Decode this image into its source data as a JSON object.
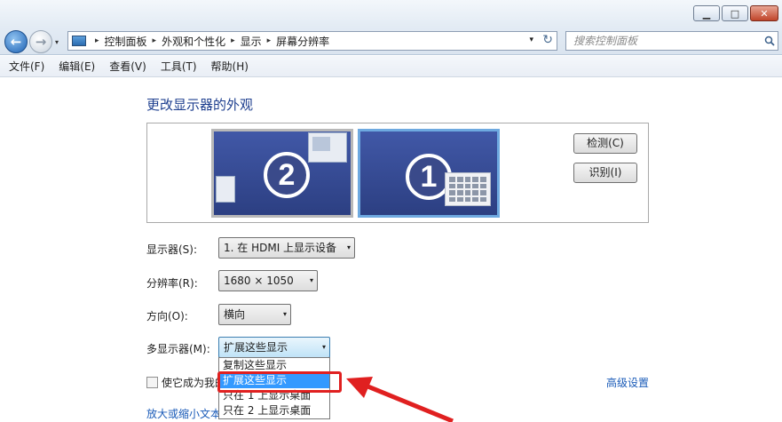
{
  "window": {
    "minimize_glyph": "▁",
    "maximize_glyph": "□",
    "close_glyph": "✕"
  },
  "nav": {
    "back_glyph": "←",
    "forward_glyph": "→",
    "dropdown_glyph": "▾"
  },
  "address": {
    "crumbs": [
      "控制面板",
      "外观和个性化",
      "显示",
      "屏幕分辨率"
    ],
    "separator": "▸",
    "dropdown_glyph": "▾",
    "refresh_glyph": "↻"
  },
  "search": {
    "placeholder": "搜索控制面板"
  },
  "menu": [
    "文件(F)",
    "编辑(E)",
    "查看(V)",
    "工具(T)",
    "帮助(H)"
  ],
  "heading": "更改显示器的外观",
  "monitors": [
    {
      "number": "2",
      "active": false
    },
    {
      "number": "1",
      "active": true
    }
  ],
  "buttons": {
    "detect": "检测(C)",
    "identify": "识别(I)"
  },
  "settings": {
    "display_label": "显示器(S):",
    "display_value": "1. 在 HDMI 上显示设备",
    "resolution_label": "分辨率(R):",
    "resolution_value": "1680 × 1050",
    "orientation_label": "方向(O):",
    "orientation_value": "横向",
    "multi_label": "多显示器(M):",
    "multi_value": "扩展这些显示",
    "combo_arrow": "▾"
  },
  "multi_options": [
    {
      "label": "复制这些显示",
      "selected": false
    },
    {
      "label": "扩展这些显示",
      "selected": true
    },
    {
      "label": "只在 1 上显示桌面",
      "selected": false
    },
    {
      "label": "只在 2 上显示桌面",
      "selected": false
    }
  ],
  "checkbox_label": "使它成为我的",
  "links": {
    "advanced": "高级设置",
    "zoom_text": "放大或缩小文本"
  },
  "colors": {
    "accent": "#1e3f8f",
    "link": "#1a5bb8",
    "selection": "#3399ff",
    "highlight": "#e02020"
  }
}
